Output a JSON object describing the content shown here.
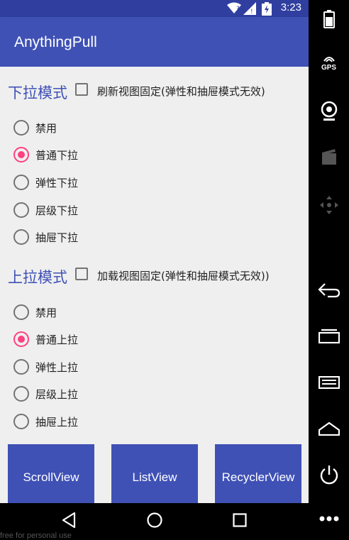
{
  "status": {
    "time": "3:23"
  },
  "app": {
    "title": "AnythingPull"
  },
  "pull_down": {
    "title": "下拉模式",
    "checkbox_label": "刷新视图固定(弹性和抽屉模式无效)",
    "checkbox_checked": false,
    "options": [
      "禁用",
      "普通下拉",
      "弹性下拉",
      "层级下拉",
      "抽屉下拉"
    ],
    "selected": "普通下拉"
  },
  "pull_up": {
    "title": "上拉模式",
    "checkbox_label": "加载视图固定(弹性和抽屉模式无效))",
    "checkbox_checked": false,
    "options": [
      "禁用",
      "普通上拉",
      "弹性上拉",
      "层级上拉",
      "抽屉上拉"
    ],
    "selected": "普通上拉"
  },
  "buttons": {
    "scroll": "ScrollView",
    "list": "ListView",
    "recycler": "RecyclerView"
  },
  "sidebar": {
    "gps_label": "GPS"
  },
  "watermark": "free for personal use",
  "colors": {
    "primary": "#3f51b5",
    "primary_dark": "#303f9f",
    "accent": "#ff4081"
  }
}
